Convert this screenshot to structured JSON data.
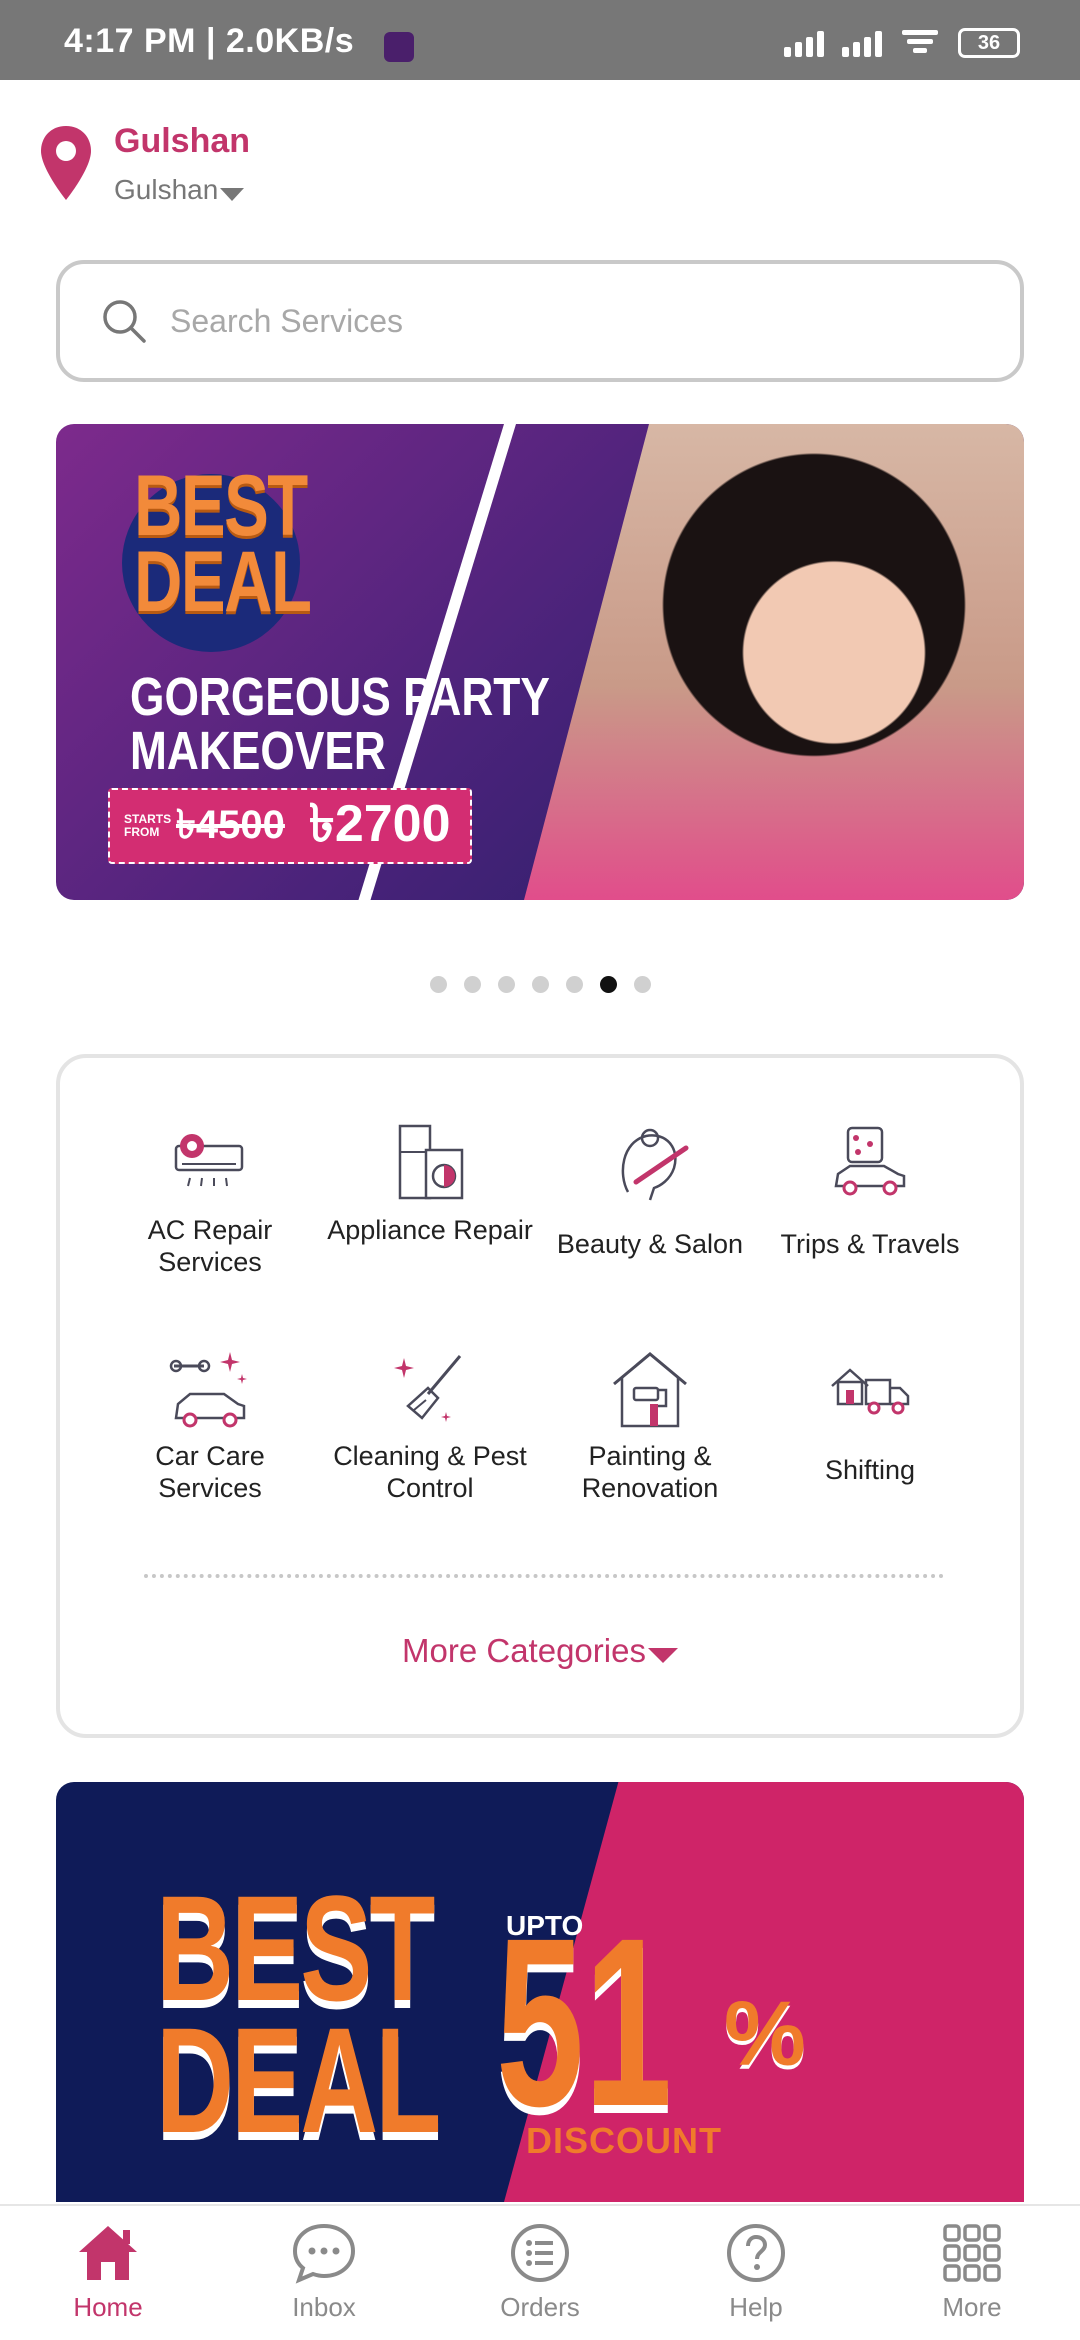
{
  "status_bar": {
    "time": "4:17 PM | 2.0KB/s",
    "battery": "36"
  },
  "location": {
    "area": "Gulshan",
    "subarea": "Gulshan"
  },
  "search": {
    "placeholder": "Search Services"
  },
  "promo_banner": {
    "badge_line1": "BEST",
    "badge_line2": "DEAL",
    "headline": "GORGEOUS PARTY\nMAKEOVER",
    "starts_from": "STARTS FROM",
    "old_price": "৳4500",
    "new_price": "৳2700",
    "carousel_count": 7,
    "carousel_active_index": 5
  },
  "categories": [
    {
      "label": "AC Repair Services",
      "icon": "ac-icon"
    },
    {
      "label": "Appliance Repair",
      "icon": "appliance-icon"
    },
    {
      "label": "Beauty & Salon",
      "icon": "beauty-icon"
    },
    {
      "label": "Trips & Travels",
      "icon": "travel-icon"
    },
    {
      "label": "Car Care Services",
      "icon": "car-care-icon"
    },
    {
      "label": "Cleaning & Pest Control",
      "icon": "cleaning-icon"
    },
    {
      "label": "Painting & Renovation",
      "icon": "painting-icon"
    },
    {
      "label": "Shifting",
      "icon": "shifting-icon"
    }
  ],
  "more_categories_label": "More Categories",
  "deal_banner": {
    "line1": "BEST",
    "line2": "DEAL",
    "upto": "UPTO",
    "percent": "51",
    "percent_sign": "%",
    "discount": "DISCOUNT"
  },
  "bottom_nav": [
    {
      "label": "Home",
      "icon": "home-icon",
      "active": true
    },
    {
      "label": "Inbox",
      "icon": "chat-icon",
      "active": false
    },
    {
      "label": "Orders",
      "icon": "list-icon",
      "active": false
    },
    {
      "label": "Help",
      "icon": "help-icon",
      "active": false
    },
    {
      "label": "More",
      "icon": "grid-icon",
      "active": false
    }
  ],
  "colors": {
    "brand": "#c2356b",
    "navy": "#1c1d62",
    "orange": "#f07b2b",
    "status_bar": "#777777"
  }
}
